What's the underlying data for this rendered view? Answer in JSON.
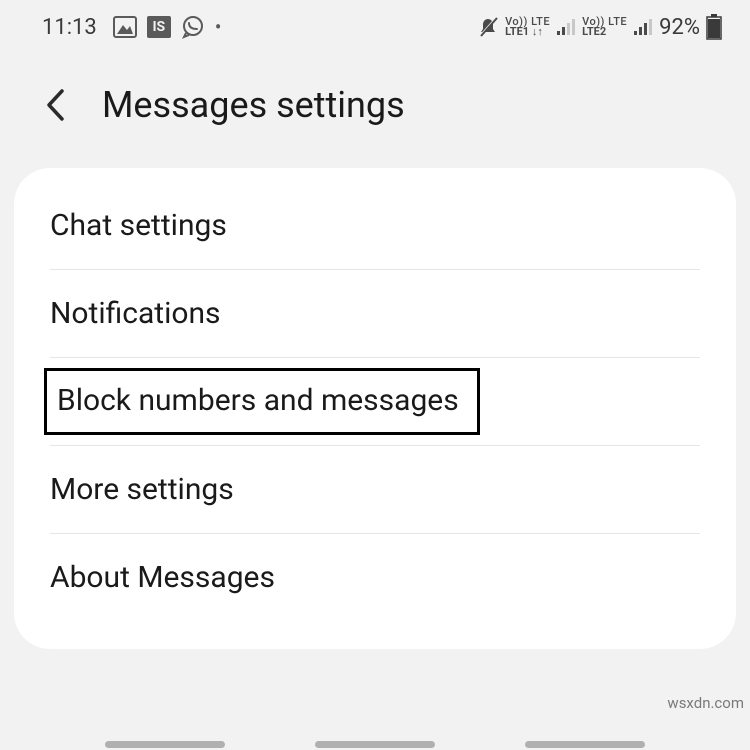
{
  "status": {
    "time": "11:13",
    "is_label": "IS",
    "lte1_top": "Vo))  LTE",
    "lte1_bottom": "LTE1 ↓↑",
    "lte2_top": "Vo))  LTE",
    "lte2_bottom": "LTE2",
    "battery": "92%"
  },
  "header": {
    "title": "Messages settings"
  },
  "rows": {
    "chat": "Chat settings",
    "notifications": "Notifications",
    "block": "Block numbers and messages",
    "more": "More settings",
    "about": "About Messages"
  },
  "watermark": "wsxdn.com"
}
